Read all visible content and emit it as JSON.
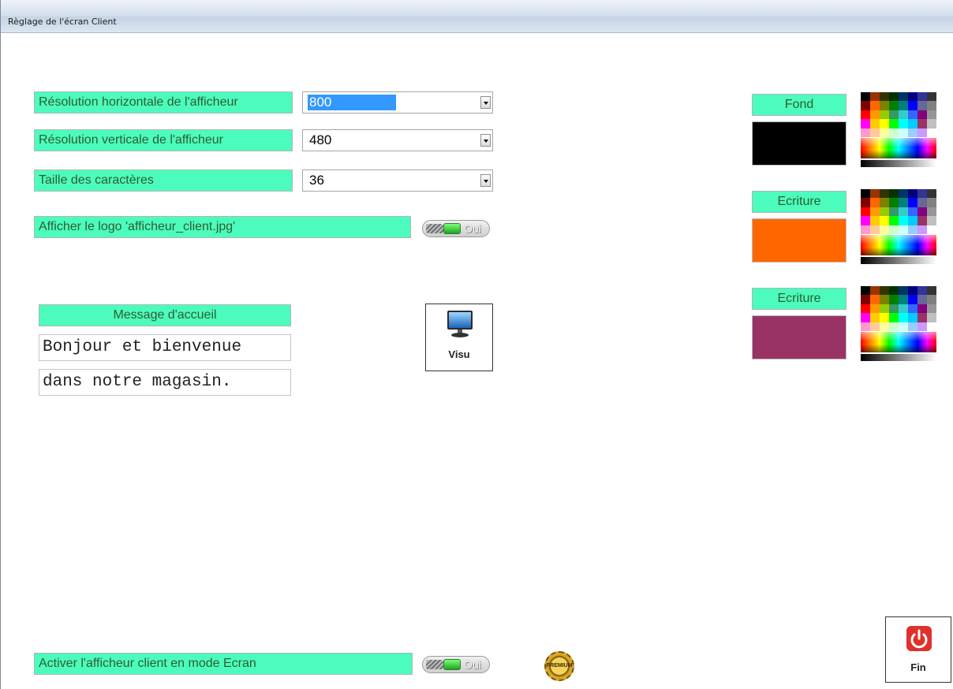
{
  "window": {
    "title": "Règlage de l'écran Client"
  },
  "settings": {
    "hres": {
      "label": "Résolution horizontale de l'afficheur",
      "value": "800"
    },
    "vres": {
      "label": "Résolution verticale de l'afficheur",
      "value": "480"
    },
    "font_size": {
      "label": "Taille des caractères",
      "value": "36"
    },
    "logo": {
      "label": "Afficher le logo 'afficheur_client.jpg'",
      "toggle": "Oui"
    },
    "activate": {
      "label": "Activer l'afficheur client en mode Ecran",
      "toggle": "Oui"
    }
  },
  "welcome": {
    "title": "Message d'accueil",
    "line1": "Bonjour et bienvenue",
    "line2": "dans notre magasin."
  },
  "buttons": {
    "visu": "Visu",
    "fin": "Fin"
  },
  "colors": {
    "fond": {
      "label": "Fond",
      "color": "#000000"
    },
    "ecriture1": {
      "label": "Ecriture",
      "color": "#ff6600"
    },
    "ecriture2": {
      "label": "Ecriture",
      "color": "#993366"
    }
  },
  "badge": {
    "text": "PREMIUM"
  },
  "palette_colors": [
    "#000000",
    "#993300",
    "#333300",
    "#003300",
    "#003366",
    "#000080",
    "#333399",
    "#333333",
    "#800000",
    "#ff6600",
    "#808000",
    "#008000",
    "#008080",
    "#0000ff",
    "#666699",
    "#808080",
    "#ff0000",
    "#ff9900",
    "#99cc00",
    "#339966",
    "#33cccc",
    "#3366ff",
    "#800080",
    "#969696",
    "#ff00ff",
    "#ffcc00",
    "#ffff00",
    "#00ff00",
    "#00ffff",
    "#00ccff",
    "#993366",
    "#c0c0c0",
    "#ff99cc",
    "#ffcc99",
    "#ffff99",
    "#ccffcc",
    "#ccffff",
    "#99ccff",
    "#cc99ff",
    "#ffffff"
  ]
}
